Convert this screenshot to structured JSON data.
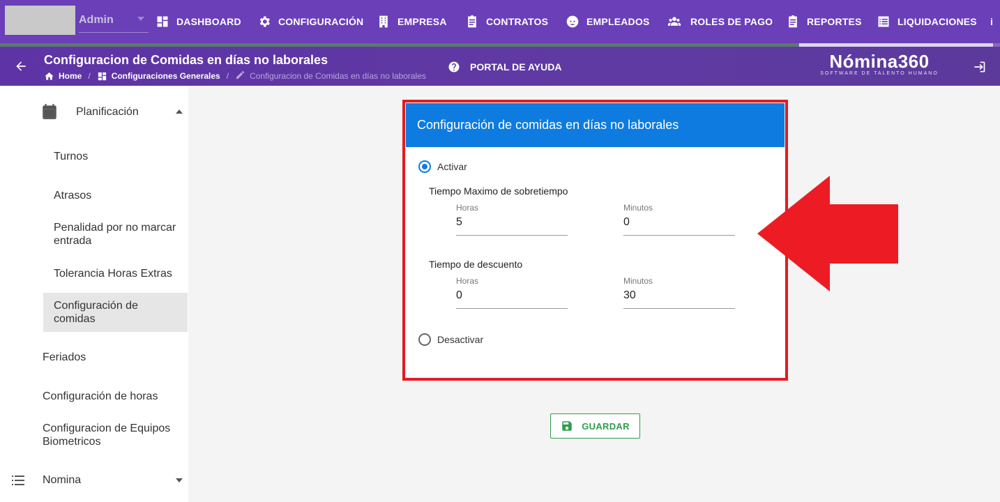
{
  "topbar": {
    "admin_label": "Admin",
    "nav": [
      {
        "label": "DASHBOARD",
        "icon": "dashboard-icon"
      },
      {
        "label": "CONFIGURACIÓN",
        "icon": "gear-icon"
      },
      {
        "label": "EMPRESA",
        "icon": "building-icon"
      },
      {
        "label": "CONTRATOS",
        "icon": "clipboard-icon"
      },
      {
        "label": "EMPLEADOS",
        "icon": "face-icon"
      },
      {
        "label": "ROLES DE PAGO",
        "icon": "people-icon"
      },
      {
        "label": "REPORTES",
        "icon": "report-icon"
      },
      {
        "label": "LIQUIDACIONES",
        "icon": "list-icon"
      },
      {
        "label": "i",
        "icon": "more-icon"
      }
    ]
  },
  "subbar": {
    "title": "Configuracion de Comidas en días no laborales",
    "breadcrumbs": [
      "Home",
      "Configuraciones Generales",
      "Configuracion de Comidas en días no laborales"
    ],
    "help_label": "PORTAL DE AYUDA",
    "brand_name": "Nómina360",
    "brand_tagline": "SOFTWARE DE TALENTO HUMANO"
  },
  "sidebar": {
    "group_label": "Planificación",
    "items": [
      "Turnos",
      "Atrasos",
      "Penalidad por no marcar entrada",
      "Tolerancia Horas Extras",
      "Configuración de comidas"
    ],
    "selected_item": "Configuración de comidas",
    "other_items": [
      "Feriados",
      "Configuración de horas",
      "Configuracion de Equipos Biometricos"
    ],
    "bottom_group": "Nomina"
  },
  "card": {
    "title": "Configuración de comidas en días no laborales",
    "option_on": "Activar",
    "option_off": "Desactivar",
    "selected_option": "Activar",
    "section1": {
      "label": "Tiempo Maximo de sobretiempo",
      "hours_label": "Horas",
      "hours_value": "5",
      "minutes_label": "Minutos",
      "minutes_value": "0"
    },
    "section2": {
      "label": "Tiempo de descuento",
      "hours_label": "Horas",
      "hours_value": "0",
      "minutes_label": "Minutos",
      "minutes_value": "30"
    }
  },
  "save_label": "GUARDAR",
  "colors": {
    "topbar": "#6a3fb8",
    "card_header": "#0e7be0",
    "highlight": "#e31b23",
    "save": "#2e9e4a"
  }
}
